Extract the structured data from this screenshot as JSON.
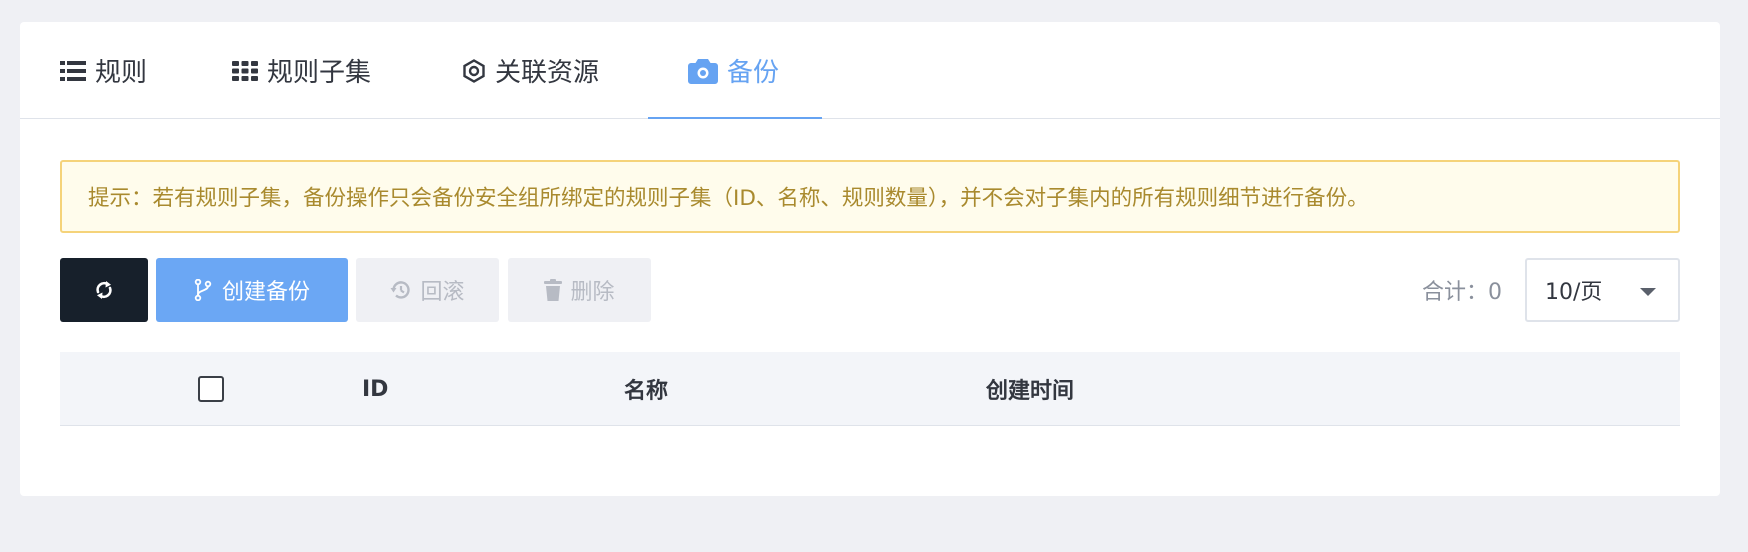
{
  "tabs": [
    {
      "label": "规则",
      "icon": "list-icon",
      "active": false
    },
    {
      "label": "规则子集",
      "icon": "grid-icon",
      "active": false
    },
    {
      "label": "关联资源",
      "icon": "hexagon-nut-icon",
      "active": false
    },
    {
      "label": "备份",
      "icon": "camera-icon",
      "active": true
    }
  ],
  "notice": {
    "text": "提示：若有规则子集，备份操作只会备份安全组所绑定的规则子集（ID、名称、规则数量），并不会对子集内的所有规则细节进行备份。"
  },
  "toolbar": {
    "refresh_icon": "refresh-icon",
    "create_label": "创建备份",
    "create_icon": "branch-icon",
    "rollback_label": "回滚",
    "rollback_icon": "history-icon",
    "delete_label": "删除",
    "delete_icon": "trash-icon"
  },
  "pagination": {
    "total_label": "合计：0",
    "page_size": "10/页"
  },
  "table": {
    "columns": [
      "ID",
      "名称",
      "创建时间"
    ],
    "rows": []
  },
  "colors": {
    "accent": "#66a3f2",
    "primary_button": "#6ba7f4",
    "dark_button": "#17202b",
    "notice_bg": "#fffcec",
    "notice_border": "#f5d37a",
    "notice_text": "#a98a2e"
  }
}
